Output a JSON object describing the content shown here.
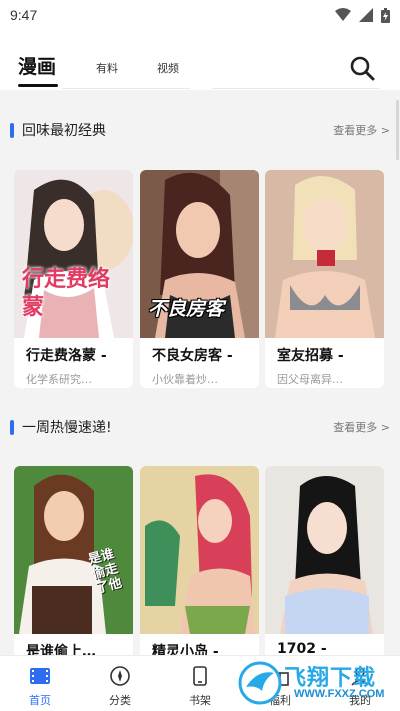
{
  "status": {
    "time": "9:47"
  },
  "tabs": [
    {
      "label": "漫画",
      "active": true
    },
    {
      "label": "有料",
      "active": false
    },
    {
      "label": "视频",
      "active": false
    }
  ],
  "sections": [
    {
      "title": "回味最初经典",
      "more": "查看更多 >",
      "cards": [
        {
          "title": "行走费洛蒙 -",
          "desc": "化学系研究…",
          "cover_text": "行走费络蒙"
        },
        {
          "title": "不良女房客 -",
          "desc": "小伙靠着炒…",
          "cover_text": "不良房客"
        },
        {
          "title": "室友招募 -",
          "desc": "因父母离异…",
          "cover_text": ""
        }
      ]
    },
    {
      "title": "一周热慢速递!",
      "more": "查看更多 >",
      "cards": [
        {
          "title": "是谁偷上…",
          "desc": "",
          "cover_text": "是谁偷走了他"
        },
        {
          "title": "精灵小岛 -",
          "desc": "",
          "cover_text": ""
        },
        {
          "title": "1702 -",
          "desc": "",
          "cover_text": ""
        }
      ]
    }
  ],
  "bottom_nav": [
    {
      "label": "首页",
      "icon": "film-icon",
      "active": true
    },
    {
      "label": "分类",
      "icon": "compass-icon",
      "active": false
    },
    {
      "label": "书架",
      "icon": "tablet-icon",
      "active": false
    },
    {
      "label": "福利",
      "icon": "gift-icon",
      "active": false
    },
    {
      "label": "我的",
      "icon": "user-icon",
      "active": false
    }
  ],
  "watermark": {
    "text": "飞翔下载",
    "url": "WWW.FXXZ.COM"
  },
  "colors": {
    "accent": "#2f6df0",
    "background": "#f3f3f3",
    "watermark": "#27a9e8"
  }
}
